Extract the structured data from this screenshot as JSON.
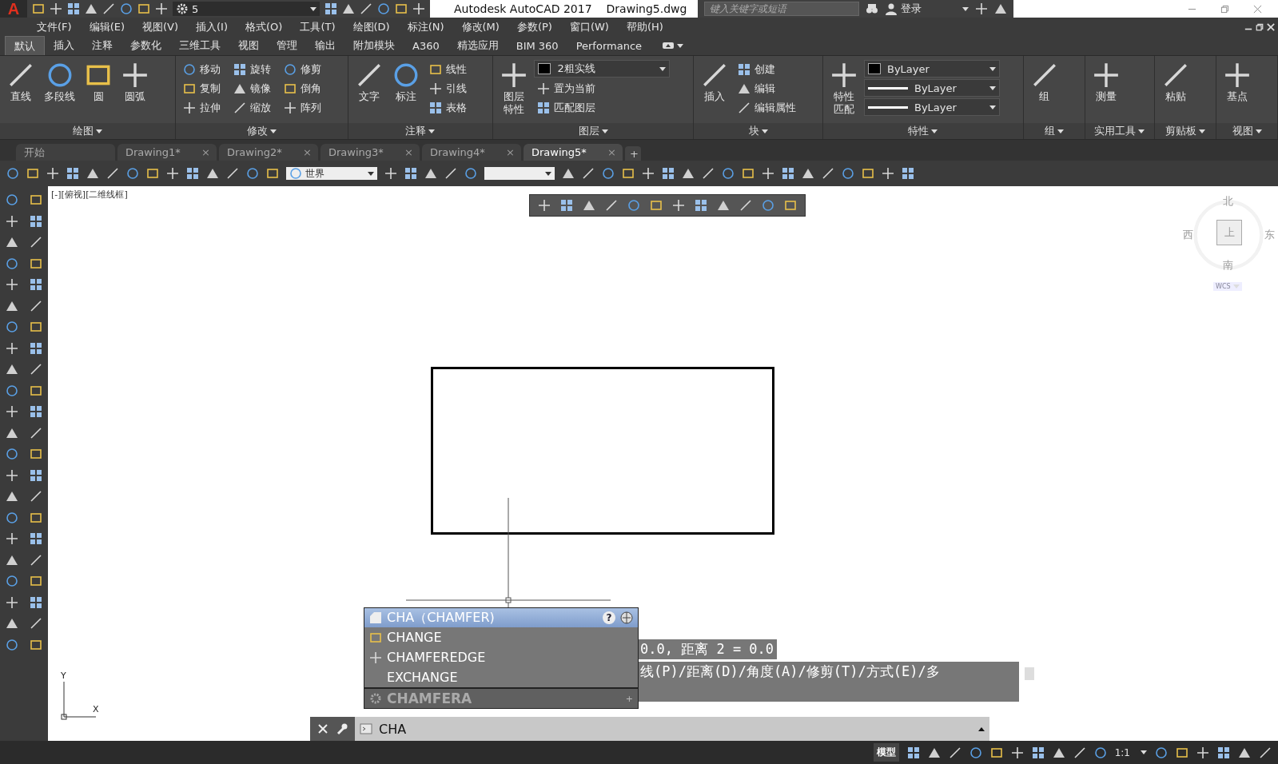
{
  "titlebar": {
    "logo": "A",
    "workspace": "5",
    "app": "Autodesk AutoCAD 2017",
    "file": "Drawing5.dwg",
    "search_placeholder": "键入关键字或短语",
    "sign_in": "登录"
  },
  "menu": [
    "文件(F)",
    "编辑(E)",
    "视图(V)",
    "插入(I)",
    "格式(O)",
    "工具(T)",
    "绘图(D)",
    "标注(N)",
    "修改(M)",
    "参数(P)",
    "窗口(W)",
    "帮助(H)"
  ],
  "ribbon_tabs": [
    {
      "label": "默认",
      "selected": true
    },
    {
      "label": "插入",
      "selected": false
    },
    {
      "label": "注释",
      "selected": false
    },
    {
      "label": "参数化",
      "selected": false
    },
    {
      "label": "三维工具",
      "selected": false
    },
    {
      "label": "视图",
      "selected": false
    },
    {
      "label": "管理",
      "selected": false
    },
    {
      "label": "输出",
      "selected": false
    },
    {
      "label": "附加模块",
      "selected": false
    },
    {
      "label": "A360",
      "selected": false
    },
    {
      "label": "精选应用",
      "selected": false
    },
    {
      "label": "BIM 360",
      "selected": false
    },
    {
      "label": "Performance",
      "selected": false
    }
  ],
  "ribbon_panels": [
    {
      "title": "绘图",
      "large": [
        "直线",
        "多段线",
        "圆",
        "圆弧"
      ]
    },
    {
      "title": "修改",
      "small": [
        "移动",
        "复制",
        "拉伸",
        "旋转",
        "镜像",
        "缩放",
        "修剪",
        "倒角",
        "阵列"
      ]
    },
    {
      "title": "注释",
      "large": [
        "文字",
        "标注"
      ],
      "small": [
        "线性",
        "引线",
        "表格"
      ]
    },
    {
      "title": "图层",
      "large": [
        "图层特性"
      ],
      "dropdowns": [
        "2粗实线"
      ],
      "small": [
        "置为当前",
        "匹配图层"
      ]
    },
    {
      "title": "块",
      "large": [
        "插入"
      ],
      "small": [
        "创建",
        "编辑",
        "编辑属性"
      ]
    },
    {
      "title": "特性",
      "large": [
        "特性匹配"
      ],
      "dropdowns": [
        "ByLayer",
        "ByLayer",
        "ByLayer"
      ]
    },
    {
      "title": "组",
      "large": [
        "组"
      ]
    },
    {
      "title": "实用工具",
      "large": [
        "测量"
      ]
    },
    {
      "title": "剪贴板",
      "large": [
        "粘贴"
      ]
    },
    {
      "title": "视图",
      "large": [
        "基点"
      ]
    }
  ],
  "file_tabs": [
    {
      "label": "开始",
      "selected": false
    },
    {
      "label": "Drawing1*",
      "selected": false,
      "close": "×"
    },
    {
      "label": "Drawing2*",
      "selected": false,
      "close": "×"
    },
    {
      "label": "Drawing3*",
      "selected": false,
      "close": "×"
    },
    {
      "label": "Drawing4*",
      "selected": false,
      "close": "×"
    },
    {
      "label": "Drawing5*",
      "selected": true,
      "close": "×"
    }
  ],
  "new_tab": "+",
  "toolbar": {
    "ucs_dropdown": "世界"
  },
  "viewport_label": "[-][俯视][二维线框]",
  "viewcube": {
    "north": "北",
    "west": "西",
    "east": "东",
    "south": "南",
    "top": "上",
    "wcs": "WCS"
  },
  "ucs_icon": {
    "x": "X",
    "y": "Y"
  },
  "autocomplete": {
    "header": "CHA（CHAMFER)",
    "help": "?",
    "items": [
      "CHANGE",
      "CHAMFEREDGE",
      "EXCHANGE"
    ],
    "footer": "CHAMFERA",
    "footer_mark": "+"
  },
  "command_history": [
    "0.0, 距离 2 = 0.0",
    "线(P)/距离(D)/角度(A)/修剪(T)/方式(E)/多"
  ],
  "command_line": {
    "value": "CHA"
  },
  "status_bar": {
    "model": "模型",
    "scale": "1:1"
  }
}
